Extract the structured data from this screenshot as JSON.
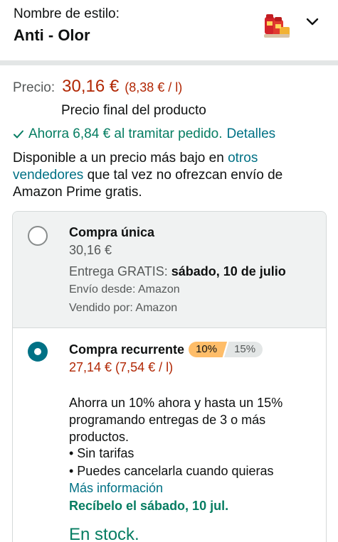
{
  "style": {
    "label": "Nombre de estilo:",
    "value": "Anti - Olor",
    "thumbnail_icon": "product-thumbnail",
    "dropdown_icon": "chevron-down-icon"
  },
  "price": {
    "label": "Precio:",
    "amount": "30,16 €",
    "unit_price": "(8,38 € / l)",
    "final_note": "Precio final del producto"
  },
  "savings": {
    "icon": "check-icon",
    "text": "Ahorra 6,84 € al tramitar pedido.",
    "link": "Detalles"
  },
  "other_sellers": {
    "prefix": "Disponible a un precio más bajo en ",
    "link": "otros vendedores",
    "suffix": " que tal vez no ofrezcan envío de Amazon Prime gratis."
  },
  "purchase_options": {
    "once": {
      "title": "Compra única",
      "price": "30,16 €",
      "delivery_prefix": "Entrega GRATIS: ",
      "delivery_date": "sábado, 10 de julio",
      "ships_from": "Envío desde: Amazon",
      "sold_by": "Vendido por: Amazon",
      "selected": false
    },
    "recurring": {
      "title": "Compra recurrente",
      "badge_primary": "10%",
      "badge_secondary": "15%",
      "price": "27,14 € (7,54 € / l)",
      "description": "Ahorra un 10% ahora y hasta un 15% programando entregas de 3 o más productos.",
      "bullet1": "• Sin tarifas",
      "bullet2": "• Puedes cancelarla cuando quieras",
      "more_info": "Más información",
      "receive": "Recíbelo el sábado, 10 jul.",
      "stock": "En stock.",
      "selected": true
    }
  },
  "colors": {
    "price_red": "#B12704",
    "link_teal": "#007185",
    "success_green": "#067D62",
    "badge_orange": "#FEBD69"
  }
}
